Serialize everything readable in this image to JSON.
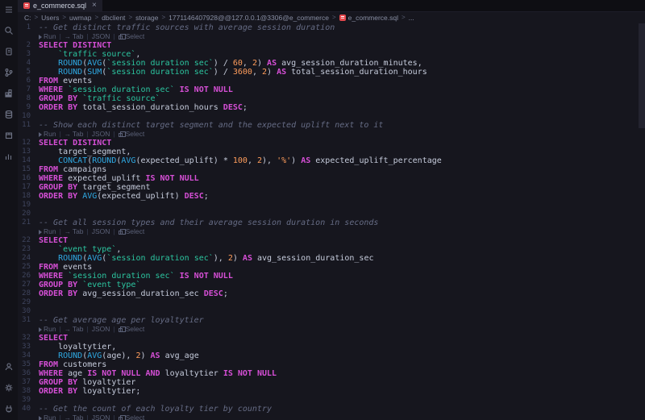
{
  "window": {
    "tab_title": "e_commerce.sql",
    "close_label": "×"
  },
  "breadcrumb": {
    "items": [
      "C:",
      "Users",
      "uwmap",
      "dbclient",
      "storage",
      "1771146407928@@127.0.0.1@3306@e_commerce",
      "e_commerce.sql",
      "..."
    ],
    "separator": ">"
  },
  "activity_bar": {
    "icons_top": [
      "menu",
      "search",
      "files",
      "source-control",
      "extensions",
      "database",
      "package",
      "chart"
    ],
    "icons_bottom": [
      "account",
      "settings",
      "plug"
    ]
  },
  "codelens": {
    "separator": "|",
    "items": [
      {
        "icon": "run-icon",
        "label": "Run"
      },
      {
        "icon": "tab-icon",
        "label": "Tab"
      },
      {
        "icon": null,
        "label": "JSON"
      },
      {
        "icon": "select-icon",
        "label": "Select"
      }
    ]
  },
  "colors": {
    "keyword": "#d64fd6",
    "function": "#2fa9e3",
    "backtick_identifier": "#2cc6a0",
    "number": "#ff9d5c",
    "string": "#ff9d5c",
    "comment": "#666c85",
    "plain_text": "#c6ccdc",
    "file_icon": "#e5484d",
    "editor_background": "#16161e"
  },
  "editor": {
    "rows": [
      {
        "n": 1,
        "t": [
          [
            "c",
            "-- Get distinct traffic sources with average session duration"
          ]
        ]
      },
      {
        "lens": true
      },
      {
        "n": 2,
        "t": [
          [
            "k",
            "SELECT"
          ],
          [
            "p",
            " "
          ],
          [
            "k",
            "DISTINCT"
          ]
        ]
      },
      {
        "n": 3,
        "t": [
          [
            "p",
            "    "
          ],
          [
            "i",
            "`traffic source`"
          ],
          [
            "p",
            ","
          ]
        ]
      },
      {
        "n": 4,
        "t": [
          [
            "p",
            "    "
          ],
          [
            "f",
            "ROUND"
          ],
          [
            "p",
            "("
          ],
          [
            "f",
            "AVG"
          ],
          [
            "p",
            "("
          ],
          [
            "i",
            "`session duration sec`"
          ],
          [
            "p",
            ") / "
          ],
          [
            "n",
            "60"
          ],
          [
            "p",
            ", "
          ],
          [
            "n",
            "2"
          ],
          [
            "p",
            ") "
          ],
          [
            "k",
            "AS"
          ],
          [
            "p",
            " avg_session_duration_minutes,"
          ]
        ]
      },
      {
        "n": 5,
        "t": [
          [
            "p",
            "    "
          ],
          [
            "f",
            "ROUND"
          ],
          [
            "p",
            "("
          ],
          [
            "f",
            "SUM"
          ],
          [
            "p",
            "("
          ],
          [
            "i",
            "`session duration sec`"
          ],
          [
            "p",
            ") / "
          ],
          [
            "n",
            "3600"
          ],
          [
            "p",
            ", "
          ],
          [
            "n",
            "2"
          ],
          [
            "p",
            ") "
          ],
          [
            "k",
            "AS"
          ],
          [
            "p",
            " total_session_duration_hours"
          ]
        ]
      },
      {
        "n": 6,
        "t": [
          [
            "k",
            "FROM"
          ],
          [
            "p",
            " events"
          ]
        ]
      },
      {
        "n": 7,
        "t": [
          [
            "k",
            "WHERE"
          ],
          [
            "p",
            " "
          ],
          [
            "i",
            "`session duration sec`"
          ],
          [
            "p",
            " "
          ],
          [
            "k",
            "IS NOT NULL"
          ]
        ]
      },
      {
        "n": 8,
        "t": [
          [
            "k",
            "GROUP BY"
          ],
          [
            "p",
            " "
          ],
          [
            "i",
            "`traffic source`"
          ]
        ]
      },
      {
        "n": 9,
        "t": [
          [
            "k",
            "ORDER BY"
          ],
          [
            "p",
            " total_session_duration_hours "
          ],
          [
            "k",
            "DESC"
          ],
          [
            "p",
            ";"
          ]
        ]
      },
      {
        "n": 10,
        "t": []
      },
      {
        "n": 11,
        "t": [
          [
            "c",
            "-- Show each distinct target segment and the expected uplift next to it"
          ]
        ]
      },
      {
        "lens": true
      },
      {
        "n": 12,
        "t": [
          [
            "k",
            "SELECT"
          ],
          [
            "p",
            " "
          ],
          [
            "k",
            "DISTINCT"
          ]
        ]
      },
      {
        "n": 13,
        "t": [
          [
            "p",
            "    target_segment,"
          ]
        ]
      },
      {
        "n": 14,
        "t": [
          [
            "p",
            "    "
          ],
          [
            "f",
            "CONCAT"
          ],
          [
            "p",
            "("
          ],
          [
            "f",
            "ROUND"
          ],
          [
            "p",
            "("
          ],
          [
            "f",
            "AVG"
          ],
          [
            "p",
            "(expected_uplift) * "
          ],
          [
            "n",
            "100"
          ],
          [
            "p",
            ", "
          ],
          [
            "n",
            "2"
          ],
          [
            "p",
            "), "
          ],
          [
            "s",
            "'%'"
          ],
          [
            "p",
            ") "
          ],
          [
            "k",
            "AS"
          ],
          [
            "p",
            " expected_uplift_percentage"
          ]
        ]
      },
      {
        "n": 15,
        "t": [
          [
            "k",
            "FROM"
          ],
          [
            "p",
            " campaigns"
          ]
        ]
      },
      {
        "n": 16,
        "t": [
          [
            "k",
            "WHERE"
          ],
          [
            "p",
            " expected_uplift "
          ],
          [
            "k",
            "IS NOT NULL"
          ]
        ]
      },
      {
        "n": 17,
        "t": [
          [
            "k",
            "GROUP BY"
          ],
          [
            "p",
            " target_segment"
          ]
        ]
      },
      {
        "n": 18,
        "t": [
          [
            "k",
            "ORDER BY"
          ],
          [
            "p",
            " "
          ],
          [
            "f",
            "AVG"
          ],
          [
            "p",
            "(expected_uplift) "
          ],
          [
            "k",
            "DESC"
          ],
          [
            "p",
            ";"
          ]
        ]
      },
      {
        "n": 19,
        "t": []
      },
      {
        "n": 20,
        "t": []
      },
      {
        "n": 21,
        "t": [
          [
            "c",
            "-- Get all session types and their average session duration in seconds"
          ]
        ]
      },
      {
        "lens": true
      },
      {
        "n": 22,
        "t": [
          [
            "k",
            "SELECT"
          ]
        ]
      },
      {
        "n": 23,
        "t": [
          [
            "p",
            "    "
          ],
          [
            "i",
            "`event type`"
          ],
          [
            "p",
            ","
          ]
        ]
      },
      {
        "n": 24,
        "t": [
          [
            "p",
            "    "
          ],
          [
            "f",
            "ROUND"
          ],
          [
            "p",
            "("
          ],
          [
            "f",
            "AVG"
          ],
          [
            "p",
            "("
          ],
          [
            "i",
            "`session duration sec`"
          ],
          [
            "p",
            "), "
          ],
          [
            "n",
            "2"
          ],
          [
            "p",
            ") "
          ],
          [
            "k",
            "AS"
          ],
          [
            "p",
            " avg_session_duration_sec"
          ]
        ]
      },
      {
        "n": 25,
        "t": [
          [
            "k",
            "FROM"
          ],
          [
            "p",
            " events"
          ]
        ]
      },
      {
        "n": 26,
        "t": [
          [
            "k",
            "WHERE"
          ],
          [
            "p",
            " "
          ],
          [
            "i",
            "`session duration sec`"
          ],
          [
            "p",
            " "
          ],
          [
            "k",
            "IS NOT NULL"
          ]
        ]
      },
      {
        "n": 27,
        "t": [
          [
            "k",
            "GROUP BY"
          ],
          [
            "p",
            " "
          ],
          [
            "i",
            "`event type`"
          ]
        ]
      },
      {
        "n": 28,
        "t": [
          [
            "k",
            "ORDER BY"
          ],
          [
            "p",
            " avg_session_duration_sec "
          ],
          [
            "k",
            "DESC"
          ],
          [
            "p",
            ";"
          ]
        ]
      },
      {
        "n": 29,
        "t": []
      },
      {
        "n": 30,
        "t": []
      },
      {
        "n": 31,
        "t": [
          [
            "c",
            "-- Get average age per loyaltytier"
          ]
        ]
      },
      {
        "lens": true
      },
      {
        "n": 32,
        "t": [
          [
            "k",
            "SELECT"
          ]
        ]
      },
      {
        "n": 33,
        "t": [
          [
            "p",
            "    loyaltytier,"
          ]
        ]
      },
      {
        "n": 34,
        "t": [
          [
            "p",
            "    "
          ],
          [
            "f",
            "ROUND"
          ],
          [
            "p",
            "("
          ],
          [
            "f",
            "AVG"
          ],
          [
            "p",
            "(age), "
          ],
          [
            "n",
            "2"
          ],
          [
            "p",
            ") "
          ],
          [
            "k",
            "AS"
          ],
          [
            "p",
            " avg_age"
          ]
        ]
      },
      {
        "n": 35,
        "t": [
          [
            "k",
            "FROM"
          ],
          [
            "p",
            " customers"
          ]
        ]
      },
      {
        "n": 36,
        "t": [
          [
            "k",
            "WHERE"
          ],
          [
            "p",
            " age "
          ],
          [
            "k",
            "IS NOT NULL"
          ],
          [
            "p",
            " "
          ],
          [
            "k",
            "AND"
          ],
          [
            "p",
            " loyaltytier "
          ],
          [
            "k",
            "IS NOT NULL"
          ]
        ]
      },
      {
        "n": 37,
        "t": [
          [
            "k",
            "GROUP BY"
          ],
          [
            "p",
            " loyaltytier"
          ]
        ]
      },
      {
        "n": 38,
        "t": [
          [
            "k",
            "ORDER BY"
          ],
          [
            "p",
            " loyaltytier;"
          ]
        ]
      },
      {
        "n": 39,
        "t": []
      },
      {
        "n": 40,
        "t": [
          [
            "c",
            "-- Get the count of each loyalty tier by country"
          ]
        ]
      },
      {
        "lens": true
      }
    ]
  }
}
